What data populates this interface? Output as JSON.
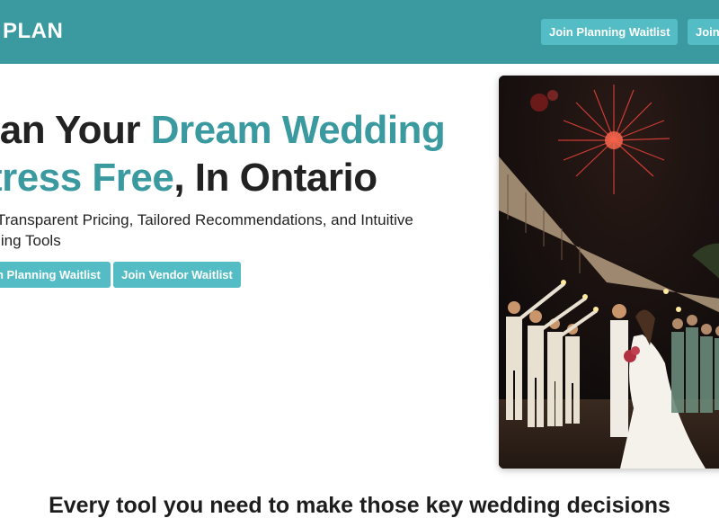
{
  "header": {
    "logo": "PLAN",
    "planning_waitlist": "Join Planning Waitlist",
    "vendor_waitlist": "Join Vendor Waitlist"
  },
  "hero": {
    "title_part1": "lan Your ",
    "title_accent1": "Dream Wedding",
    "title_accent2": "tress Free",
    "title_part2": ", In Ontario",
    "subtitle_line1": "d Transparent Pricing, Tailored Recommendations, and Intuitive",
    "subtitle_line2": "nning Tools",
    "planning_waitlist": "n Planning Waitlist",
    "vendor_waitlist": "Join Vendor Waitlist"
  },
  "features": {
    "heading": "Every tool you need to make those key wedding decisions"
  },
  "colors": {
    "brand_teal": "#3a9aa0",
    "button_teal": "#53bcc4"
  }
}
